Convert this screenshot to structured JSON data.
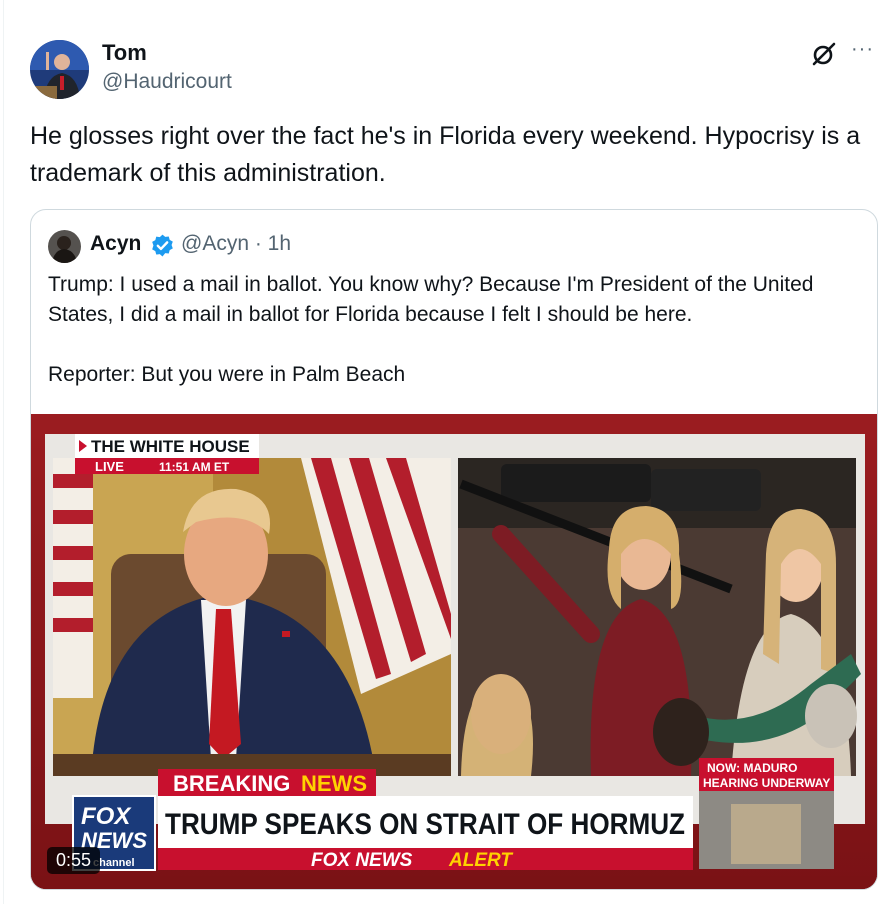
{
  "tweet": {
    "author_name": "Tom",
    "author_handle": "@Haudricourt",
    "text": "He glosses right over the fact he's in Florida every weekend. Hypocrisy is a trademark of this administration.",
    "more_label": "···"
  },
  "quote": {
    "author_name": "Acyn",
    "author_handle": "@Acyn · 1h",
    "text": "Trump: I used a mail in ballot. You know why? Because I'm President of the United States, I did a mail in ballot for Florida because I felt I should be here.\n\nReporter: But you were in Palm Beach"
  },
  "video": {
    "duration": "0:55",
    "location_tag": "THE WHITE HOUSE",
    "live_label": "LIVE",
    "live_time": "11:51 AM ET",
    "breaking_a": "BREAKING",
    "breaking_b": "NEWS",
    "headline": "TRUMP SPEAKS ON STRAIT OF HORMUZ",
    "alert_a": "FOX NEWS",
    "alert_b": "ALERT",
    "logo_line1": "FOX",
    "logo_line2": "NEWS",
    "logo_line3": "channel",
    "side_caption_1": "NOW: MADURO",
    "side_caption_2": "HEARING UNDERWAY"
  },
  "colors": {
    "verified": "#1d9bf0",
    "fox_red": "#c8102e",
    "fox_yellow": "#ffd200",
    "fox_blue": "#1a3a7a"
  }
}
